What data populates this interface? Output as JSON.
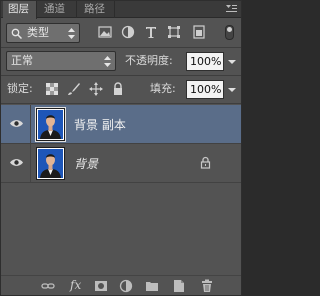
{
  "tabs": [
    {
      "label": "图层"
    },
    {
      "label": "通道"
    },
    {
      "label": "路径"
    }
  ],
  "filter": {
    "kind_select_value": "类型",
    "search_prefix_icon": "search-icon",
    "filter_icons": [
      "image-filter-icon",
      "adjustment-filter-icon",
      "type-filter-icon",
      "shape-filter-icon",
      "smartobject-filter-icon"
    ]
  },
  "blend": {
    "mode_value": "正常",
    "opacity_label": "不透明度:",
    "opacity_value": "100%"
  },
  "locks": {
    "label": "锁定:",
    "fill_label": "填充:",
    "fill_value": "100%"
  },
  "layers": [
    {
      "name": "背景 副本",
      "selected": true,
      "visible": true,
      "locked": false,
      "italic": false
    },
    {
      "name": "背景",
      "selected": false,
      "visible": true,
      "locked": true,
      "italic": true
    }
  ],
  "bottom_toolbar": {
    "fx_label": "fx",
    "icons": [
      "link-layers-icon",
      "fx-icon",
      "layer-mask-icon",
      "adjustment-layer-icon",
      "new-group-icon",
      "new-layer-icon",
      "trash-icon"
    ]
  },
  "colors": {
    "panel_bg": "#535353",
    "selected_row": "#5a6d89",
    "photo_bg": "#1e56b8"
  }
}
